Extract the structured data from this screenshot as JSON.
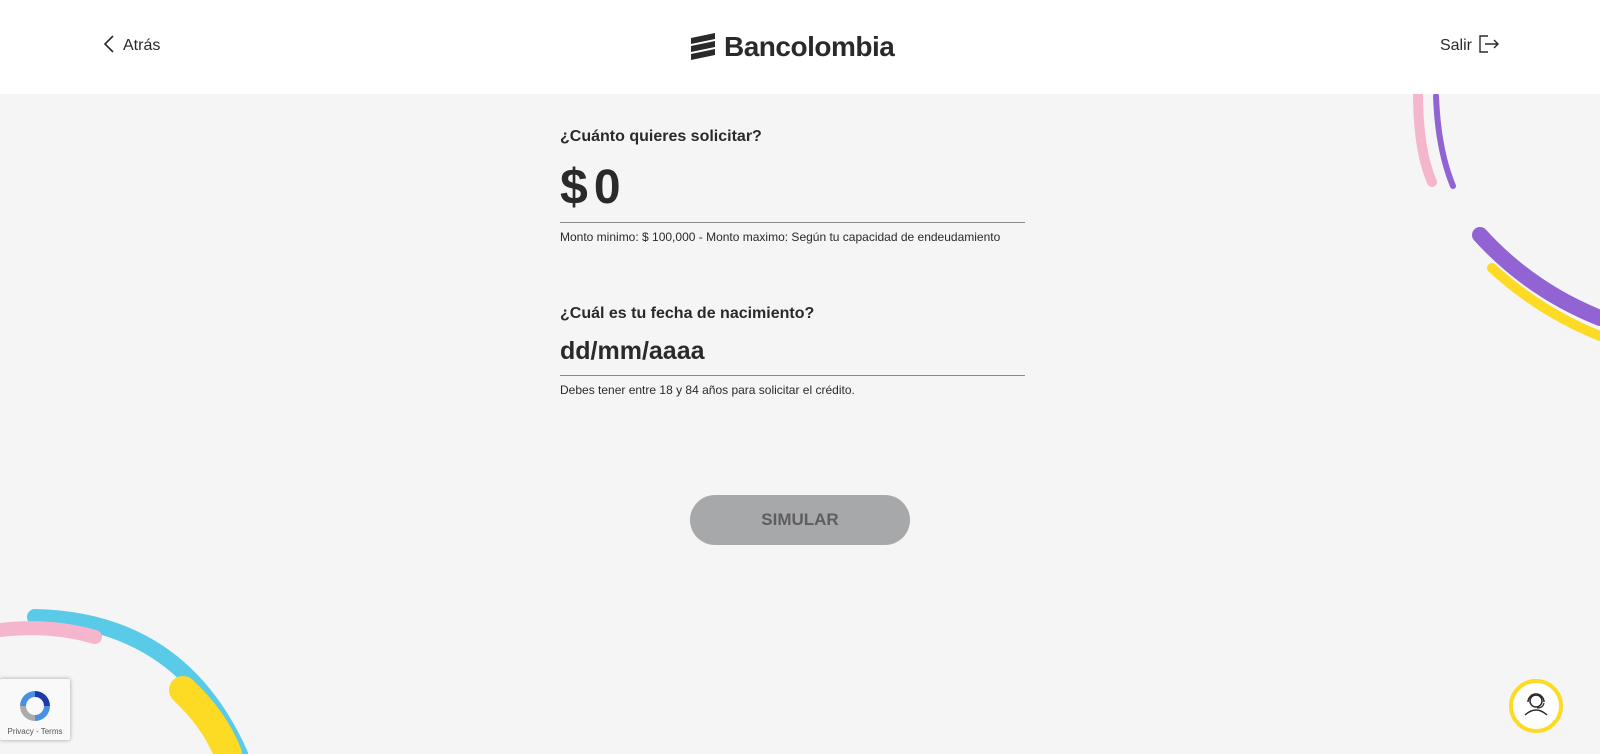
{
  "header": {
    "back_label": "Atrás",
    "brand": "Bancolombia",
    "exit_label": "Salir"
  },
  "form": {
    "amount_question": "¿Cuánto quieres solicitar?",
    "currency_symbol": "$",
    "amount_value": "0",
    "amount_hint": "Monto minimo: $ 100,000 - Monto maximo: Según tu capacidad de endeudamiento",
    "birthdate_question": "¿Cuál es tu fecha de nacimiento?",
    "birthdate_placeholder": "dd/mm/aaaa",
    "birthdate_hint": "Debes tener entre 18 y 84 años para solicitar el crédito.",
    "submit_label": "SIMULAR"
  },
  "recaptcha": {
    "terms_text": "Privacy - Terms"
  },
  "icons": {
    "back": "chevron-left-icon",
    "exit": "logout-icon",
    "brand": "bancolombia-logo-icon",
    "support": "agent-headset-icon"
  },
  "colors": {
    "header_bg": "#ffffff",
    "page_bg": "#f5f5f5",
    "text": "#2c2a29",
    "button_disabled": "#a7a8aa",
    "accent_yellow": "#fdda24",
    "accent_purple": "#9163d3",
    "accent_pink": "#f5b6cd",
    "accent_blue": "#59cbe8"
  }
}
